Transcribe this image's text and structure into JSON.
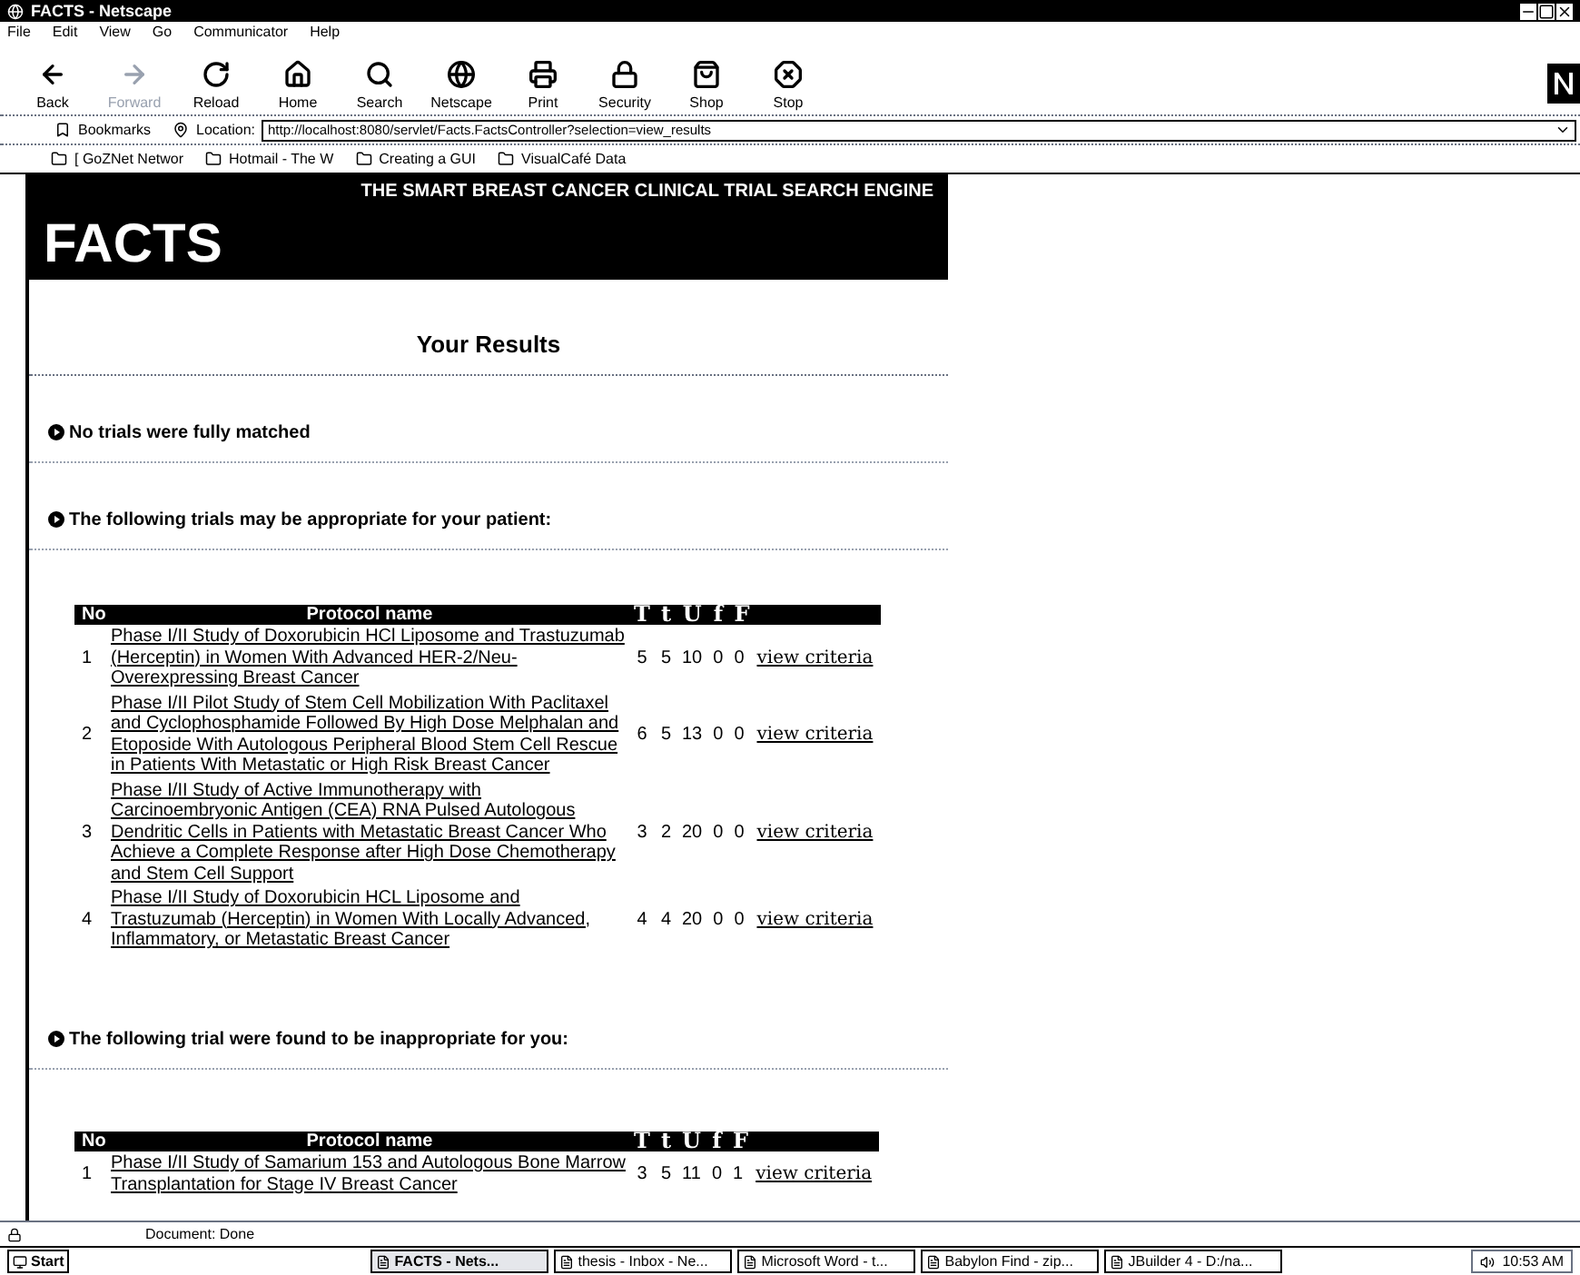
{
  "window": {
    "title": "FACTS - Netscape"
  },
  "menu": [
    "File",
    "Edit",
    "View",
    "Go",
    "Communicator",
    "Help"
  ],
  "toolbar": [
    {
      "label": "Back",
      "disabled": false
    },
    {
      "label": "Forward",
      "disabled": true
    },
    {
      "label": "Reload",
      "disabled": false
    },
    {
      "label": "Home",
      "disabled": false
    },
    {
      "label": "Search",
      "disabled": false
    },
    {
      "label": "Netscape",
      "disabled": false
    },
    {
      "label": "Print",
      "disabled": false
    },
    {
      "label": "Security",
      "disabled": false
    },
    {
      "label": "Shop",
      "disabled": false
    },
    {
      "label": "Stop",
      "disabled": false
    }
  ],
  "location_bar": {
    "bookmarks": "Bookmarks",
    "label": "Location:",
    "url": "http://localhost:8080/servlet/Facts.FactsController?selection=view_results"
  },
  "personal_toolbar": [
    "[ GoZNet Networ",
    "Hotmail - The W",
    "Creating a GUI",
    "VisualCafé Data"
  ],
  "banner": {
    "logo": "FACTS",
    "tagline": "THE SMART BREAST CANCER CLINICAL TRIAL SEARCH ENGINE"
  },
  "heading": "Your Results",
  "sections": [
    {
      "text": "No trials were fully matched"
    },
    {
      "text": "The following trials may be appropriate for your patient:",
      "table": {
        "columns": [
          "No",
          "Protocol name",
          "T",
          "t",
          "U",
          "f",
          "F"
        ],
        "rows": [
          {
            "no": "1",
            "protocol": "Phase I/II Study of Doxorubicin HCl Liposome and Trastuzumab (Herceptin) in Women With Advanced HER-2/Neu-Overexpressing Breast Cancer",
            "values": [
              "5",
              "5",
              "10",
              "0",
              "0"
            ],
            "link": "view criteria"
          },
          {
            "no": "2",
            "protocol": "Phase I/II Pilot Study of Stem Cell Mobilization With Paclitaxel and Cyclophosphamide Followed By High Dose Melphalan and Etoposide With Autologous Peripheral Blood Stem Cell Rescue in Patients With Metastatic or High Risk Breast Cancer",
            "values": [
              "6",
              "5",
              "13",
              "0",
              "0"
            ],
            "link": "view criteria"
          },
          {
            "no": "3",
            "protocol": "Phase I/II Study of Active Immunotherapy with Carcinoembryonic Antigen (CEA) RNA Pulsed Autologous Dendritic Cells in Patients with Metastatic Breast Cancer Who Achieve a Complete Response after High Dose Chemotherapy and Stem Cell Support",
            "values": [
              "3",
              "2",
              "20",
              "0",
              "0"
            ],
            "link": "view criteria"
          },
          {
            "no": "4",
            "protocol": "Phase I/II Study of Doxorubicin HCL Liposome and Trastuzumab (Herceptin) in Women With Locally Advanced, Inflammatory, or Metastatic Breast Cancer",
            "values": [
              "4",
              "4",
              "20",
              "0",
              "0"
            ],
            "link": "view criteria"
          }
        ]
      }
    },
    {
      "text": "The following trial were found to be inappropriate for you:",
      "table": {
        "columns": [
          "No",
          "Protocol name",
          "T",
          "t",
          "U",
          "f",
          "F"
        ],
        "rows": [
          {
            "no": "1",
            "protocol": "Phase I/II Study of Samarium 153 and Autologous Bone Marrow Transplantation for Stage IV Breast Cancer",
            "values": [
              "3",
              "5",
              "11",
              "0",
              "1"
            ],
            "link": "view criteria"
          }
        ]
      }
    }
  ],
  "status_bar": "Document: Done",
  "taskbar": {
    "start": "Start",
    "tasks": [
      {
        "label": "FACTS - Nets...",
        "selected": true
      },
      {
        "label": "thesis - Inbox - Ne...",
        "selected": false
      },
      {
        "label": "Microsoft Word - t...",
        "selected": false
      },
      {
        "label": "Babylon Find - zip...",
        "selected": false
      },
      {
        "label": "JBuilder 4 - D:/na...",
        "selected": false
      }
    ],
    "clock": "10:53 AM"
  }
}
